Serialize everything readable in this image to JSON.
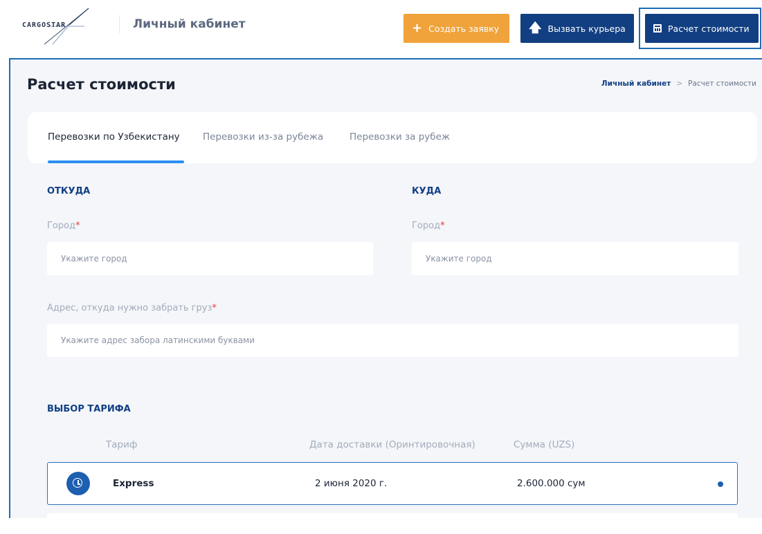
{
  "header": {
    "logo_text": "CARGOSTAR",
    "cabinet_title": "Личный кабинет",
    "buttons": {
      "create": "Создать заявку",
      "courier": "Вызвать курьера",
      "calc": "Расчет стоимости"
    }
  },
  "page": {
    "title": "Расчет стоимости",
    "breadcrumb": {
      "home": "Личный кабинет",
      "separator": ">",
      "current": "Расчет стоимости"
    }
  },
  "tabs": [
    {
      "label": "Перевозки по Узбекистану",
      "active": true
    },
    {
      "label": "Перевозки из-за рубежа",
      "active": false
    },
    {
      "label": "Перевозки за рубеж",
      "active": false
    }
  ],
  "form": {
    "from": {
      "title": "ОТКУДА",
      "city_label": "Город",
      "city_placeholder": "Укажите город",
      "address_label": "Адрес, откуда нужно забрать груз",
      "address_placeholder": "Укажите адрес забора латинскими буквами"
    },
    "to": {
      "title": "КУДА",
      "city_label": "Город",
      "city_placeholder": "Укажите город"
    },
    "required_mark": "*"
  },
  "tariffs": {
    "title": "ВЫБОР ТАРИФА",
    "columns": [
      "Тариф",
      "Дата доставки (Оринтировочная)",
      "Сумма (UZS)"
    ],
    "rows": [
      {
        "name": "Express",
        "date": "2 июня 2020 г.",
        "price": "2.600.000 сум",
        "selected": true,
        "icon": "clock-icon"
      }
    ]
  },
  "colors": {
    "accent_orange": "#f0a23b",
    "primary_navy": "#123f82",
    "tab_active": "#2d8ef0",
    "required": "#e23c3c"
  }
}
